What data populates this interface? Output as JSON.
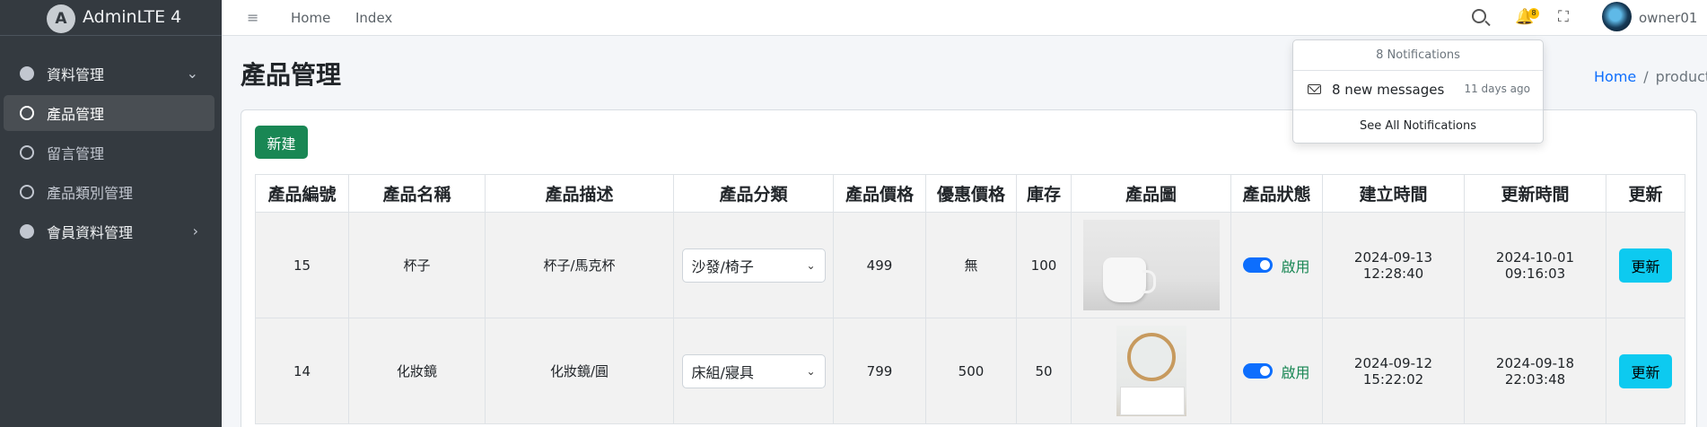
{
  "brand": {
    "name": "AdminLTE 4",
    "logo_letter": "A"
  },
  "sidebar": {
    "items": [
      {
        "label": "資料管理",
        "icon": "palette-icon",
        "arrow": "⌄"
      },
      {
        "label": "產品管理",
        "icon": "circle-icon"
      },
      {
        "label": "留言管理",
        "icon": "circle-icon"
      },
      {
        "label": "產品類別管理",
        "icon": "circle-icon"
      },
      {
        "label": "會員資料管理",
        "icon": "person-circle-icon",
        "arrow": "›"
      }
    ]
  },
  "topbar": {
    "menu_icon": "≡",
    "links": [
      "Home",
      "Index"
    ],
    "notification_count": "8",
    "bell_glyph": "🔔",
    "fullscreen_glyph": "⛶",
    "username": "owner01"
  },
  "notifications": {
    "header": "8 Notifications",
    "item_text": "8 new messages",
    "item_time": "11 days ago",
    "footer": "See All Notifications"
  },
  "page": {
    "title": "產品管理",
    "breadcrumb": {
      "home": "Home",
      "separator": "/",
      "current": "product"
    },
    "new_button": "新建"
  },
  "table": {
    "headers": [
      "產品編號",
      "產品名稱",
      "產品描述",
      "產品分類",
      "產品價格",
      "優惠價格",
      "庫存",
      "產品圖",
      "產品狀態",
      "建立時間",
      "更新時間",
      "更新"
    ],
    "rows": [
      {
        "id": "15",
        "name": "杯子",
        "desc": "杯子/馬克杯",
        "category": "沙發/椅子",
        "price": "499",
        "sale": "無",
        "stock": "100",
        "image": "cup-photo",
        "status": "啟用",
        "status_on": true,
        "created": "2024-09-13 12:28:40",
        "updated": "2024-10-01 09:16:03",
        "action": "更新"
      },
      {
        "id": "14",
        "name": "化妝鏡",
        "desc": "化妝鏡/圓",
        "category": "床組/寢具",
        "price": "799",
        "sale": "500",
        "stock": "50",
        "image": "mirror-photo",
        "status": "啟用",
        "status_on": true,
        "created": "2024-09-12 15:22:02",
        "updated": "2024-09-18 22:03:48",
        "action": "更新"
      }
    ]
  },
  "colors": {
    "sidebar": "#343a40",
    "primary": "#0d6efd",
    "success": "#198754",
    "info": "#0dcaf0",
    "warning": "#ffc107"
  }
}
